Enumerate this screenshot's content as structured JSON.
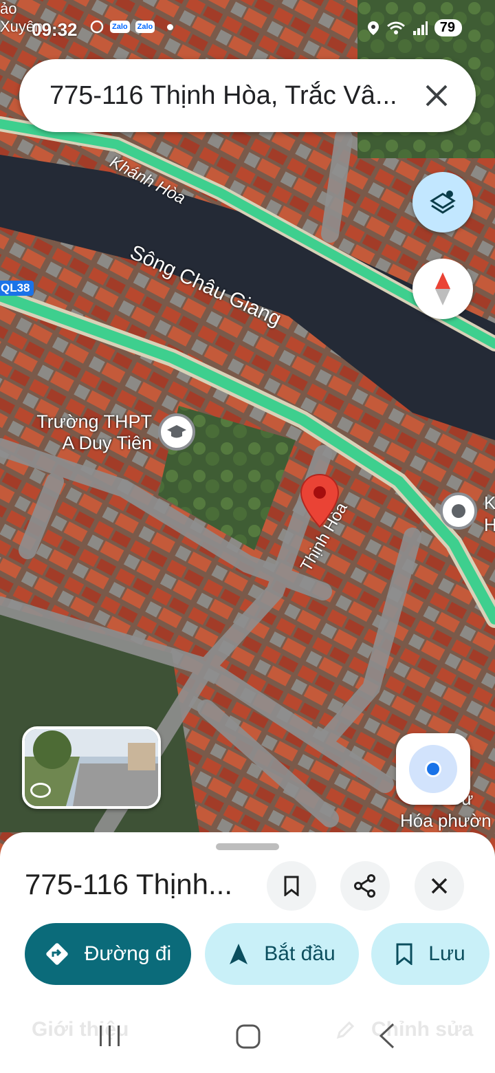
{
  "status_bar": {
    "time": "09:32",
    "corner_text_top": "ảo",
    "corner_text_bottom": "Xuyên",
    "zalo_label": "Zalo",
    "battery": "79",
    "icons": [
      "location-icon",
      "wifi-icon",
      "signal-icon",
      "battery-icon"
    ]
  },
  "search": {
    "query": "775-116 Thịnh Hòa, Trắc Vâ..."
  },
  "map": {
    "labels": {
      "road_khanh_hoa": "Khánh Hòa",
      "river": "Sông Châu Giang",
      "road_shield": "QL38",
      "school_line1": "Trường THPT",
      "school_line2": "A Duy Tiên",
      "road_thinh_hoa": "Thịnh Hòa",
      "poi_right_k": "K",
      "poi_right_h": "H",
      "poi_bottom_1": "n Bư",
      "poi_bottom_2": "Hóa phườn"
    },
    "colors": {
      "highway": "#3ecf8e",
      "pin": "#ea4335",
      "accent": "#0b6b7a"
    }
  },
  "sheet": {
    "title": "775-116 Thịnh...",
    "actions": [
      {
        "label": "Đường đi",
        "icon": "directions-icon"
      },
      {
        "label": "Bắt đầu",
        "icon": "navigation-icon"
      },
      {
        "label": "Lưu",
        "icon": "bookmark-icon"
      }
    ],
    "faded_left": "Giới thiệu",
    "faded_right": "Chỉnh sửa"
  }
}
